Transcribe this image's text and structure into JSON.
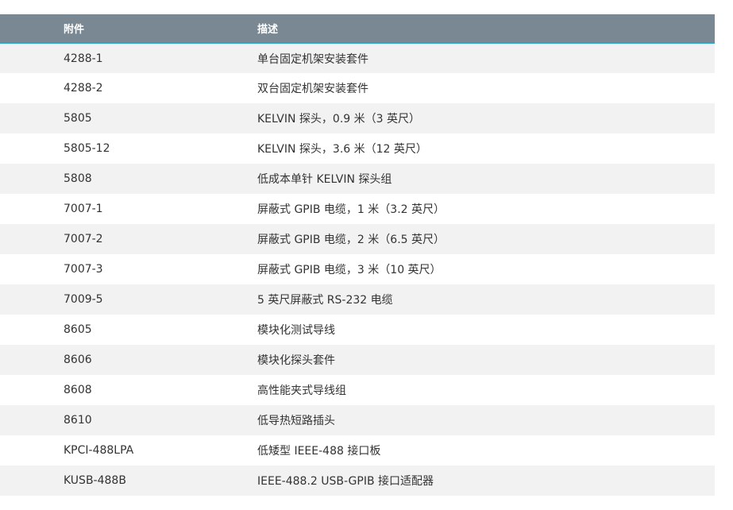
{
  "table": {
    "headers": [
      "附件",
      "描述"
    ],
    "rows": [
      [
        "4288-1",
        "单台固定机架安装套件"
      ],
      [
        "4288-2",
        "双台固定机架安装套件"
      ],
      [
        "5805",
        "KELVIN 探头，0.9 米（3 英尺）"
      ],
      [
        "5805-12",
        "KELVIN 探头，3.6 米（12 英尺）"
      ],
      [
        "5808",
        "低成本单针 KELVIN 探头组"
      ],
      [
        "7007-1",
        "屏蔽式 GPIB 电缆，1 米（3.2 英尺）"
      ],
      [
        "7007-2",
        "屏蔽式 GPIB 电缆，2 米（6.5 英尺）"
      ],
      [
        "7007-3",
        "屏蔽式 GPIB 电缆，3 米（10 英尺）"
      ],
      [
        "7009-5",
        "5 英尺屏蔽式 RS-232 电缆"
      ],
      [
        "8605",
        "模块化测试导线"
      ],
      [
        "8606",
        "模块化探头套件"
      ],
      [
        "8608",
        "高性能夹式导线组"
      ],
      [
        "8610",
        "低导热短路插头"
      ],
      [
        "KPCI-488LPA",
        "低矮型 IEEE-488 接口板"
      ],
      [
        "KUSB-488B",
        "IEEE-488.2 USB-GPIB 接口适配器"
      ]
    ]
  },
  "colors": {
    "header_bg": "#798893",
    "header_accent": "#2aa6c9",
    "row_alt": "#f2f2f2",
    "text": "#333333"
  }
}
